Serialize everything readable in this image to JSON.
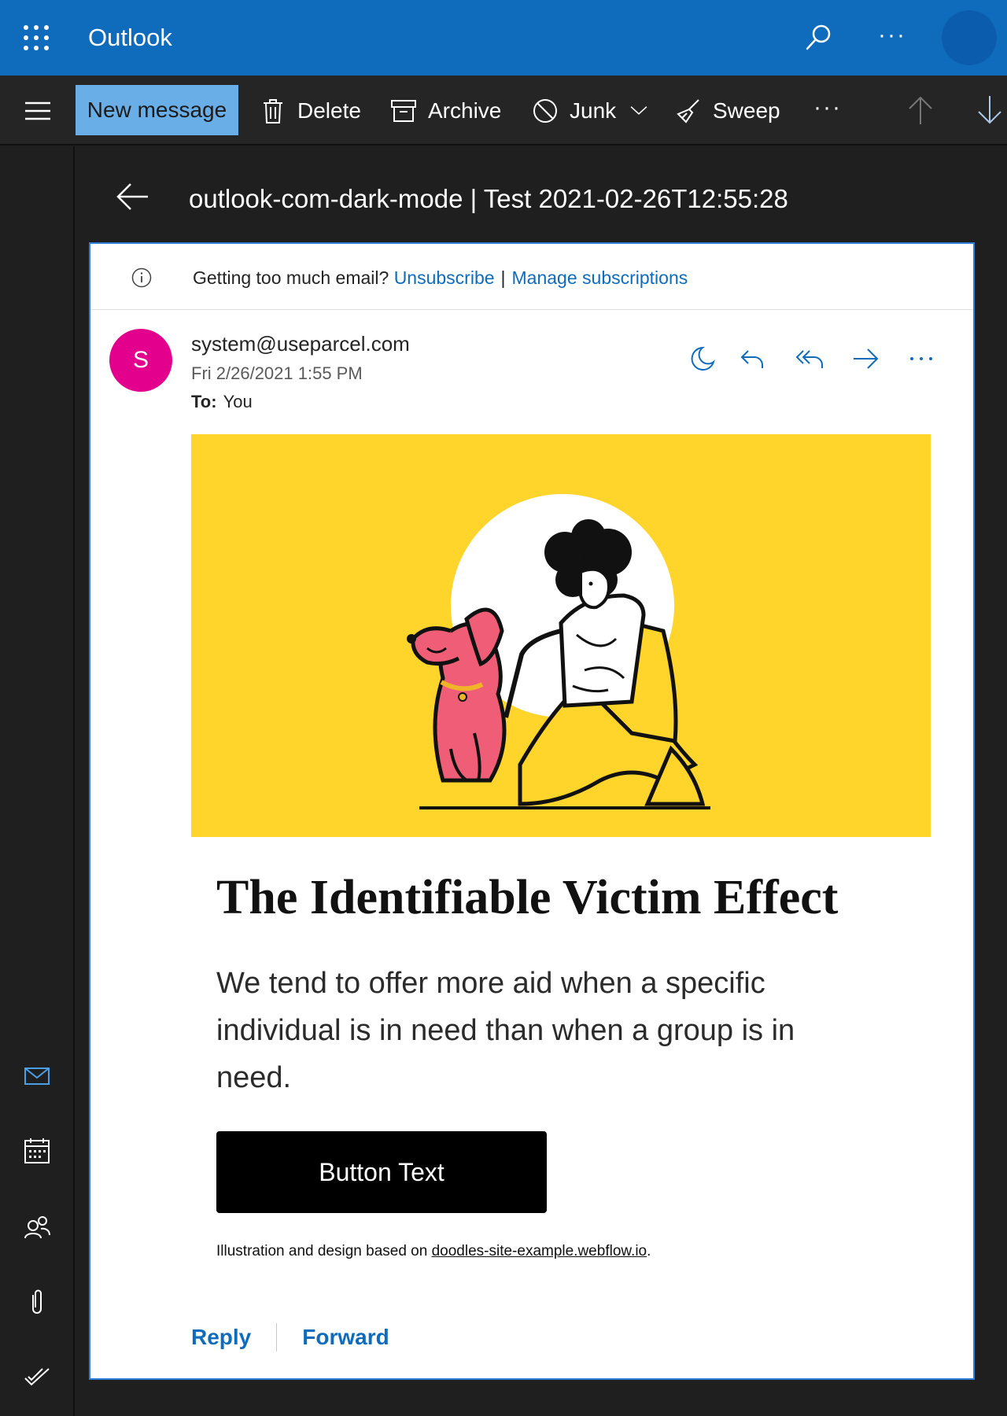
{
  "app": {
    "title": "Outlook"
  },
  "toolbar": {
    "new_message": "New message",
    "delete": "Delete",
    "archive": "Archive",
    "junk": "Junk",
    "sweep": "Sweep",
    "more": "···"
  },
  "topbar": {
    "more": "···"
  },
  "message": {
    "subject": "outlook-com-dark-mode | Test 2021-02-26T12:55:28",
    "notice": {
      "text": "Getting too much email?",
      "unsubscribe": "Unsubscribe",
      "separator": "|",
      "manage": "Manage subscriptions"
    },
    "sender": {
      "initial": "S",
      "email": "system@useparcel.com",
      "date": "Fri 2/26/2021 1:55 PM",
      "to_label": "To:",
      "to_value": "You"
    },
    "more": "···",
    "body": {
      "title": "The Identifiable Victim Effect",
      "paragraph": "We tend to offer more aid when a specific individual is in need than when a group is in need.",
      "button": "Button Text",
      "credit_prefix": "Illustration and design based on ",
      "credit_link": "doodles-site-example.webflow.io",
      "credit_suffix": "."
    },
    "reply": "Reply",
    "forward": "Forward"
  },
  "colors": {
    "brand": "#0f6cbd",
    "toolbar_bg": "#252525",
    "new_message_bg": "#6aaee8",
    "hero_bg": "#ffd42b",
    "avatar_bg": "#e3008c",
    "dog": "#ef5e76"
  },
  "icons": [
    "waffle-icon",
    "search-icon",
    "hamburger-icon",
    "delete-icon",
    "archive-icon",
    "junk-icon",
    "chevron-down-icon",
    "sweep-icon",
    "arrow-up-icon",
    "arrow-down-icon",
    "back-arrow-icon",
    "info-icon",
    "moon-icon",
    "reply-icon",
    "reply-all-icon",
    "forward-icon",
    "mail-icon",
    "calendar-icon",
    "people-icon",
    "attachment-icon",
    "todo-icon"
  ]
}
